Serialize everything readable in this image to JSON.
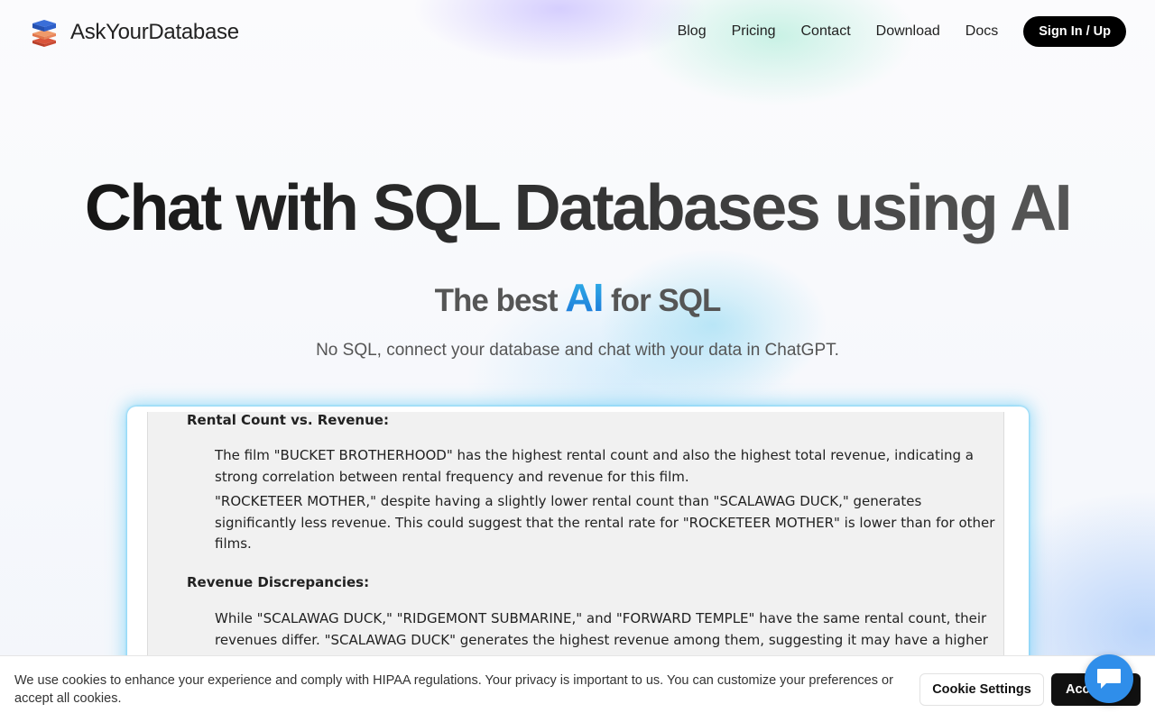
{
  "brand": {
    "name": "AskYourDatabase"
  },
  "nav": {
    "links": [
      "Blog",
      "Pricing",
      "Contact",
      "Download",
      "Docs"
    ],
    "signin_label": "Sign In / Up"
  },
  "hero": {
    "title": "Chat with SQL Databases using AI",
    "tagline_prefix": "The best",
    "tagline_highlight": "AI",
    "tagline_suffix": "for SQL",
    "subtitle": "No SQL, connect your database and chat with your data in ChatGPT."
  },
  "preview": {
    "heading1": "Rental Count vs. Revenue:",
    "para1": "The film \"BUCKET BROTHERHOOD\" has the highest rental count and also the highest total revenue, indicating a strong correlation between rental frequency and revenue for this film.",
    "para2": "\"ROCKETEER MOTHER,\" despite having a slightly lower rental count than \"SCALAWAG DUCK,\" generates significantly less revenue. This could suggest that the rental rate for \"ROCKETEER MOTHER\" is lower than for other films.",
    "heading2": "Revenue Discrepancies:",
    "para3": "While \"SCALAWAG DUCK,\" \"RIDGEMONT SUBMARINE,\" and \"FORWARD TEMPLE\" have the same rental count, their revenues differ. \"SCALAWAG DUCK\" generates the highest revenue among them, suggesting it may have a higher"
  },
  "cookie": {
    "text": "We use cookies to enhance your experience and comply with HIPAA regulations. Your privacy is important to us. You can customize your preferences or accept all cookies.",
    "settings_label": "Cookie Settings",
    "accept_label": "Accept All"
  },
  "icons": {
    "logo": "stacked-database-logo-icon",
    "chat": "chat-bubble-icon"
  },
  "colors": {
    "accent": "#2f8eea",
    "primary_button": "#000000"
  }
}
